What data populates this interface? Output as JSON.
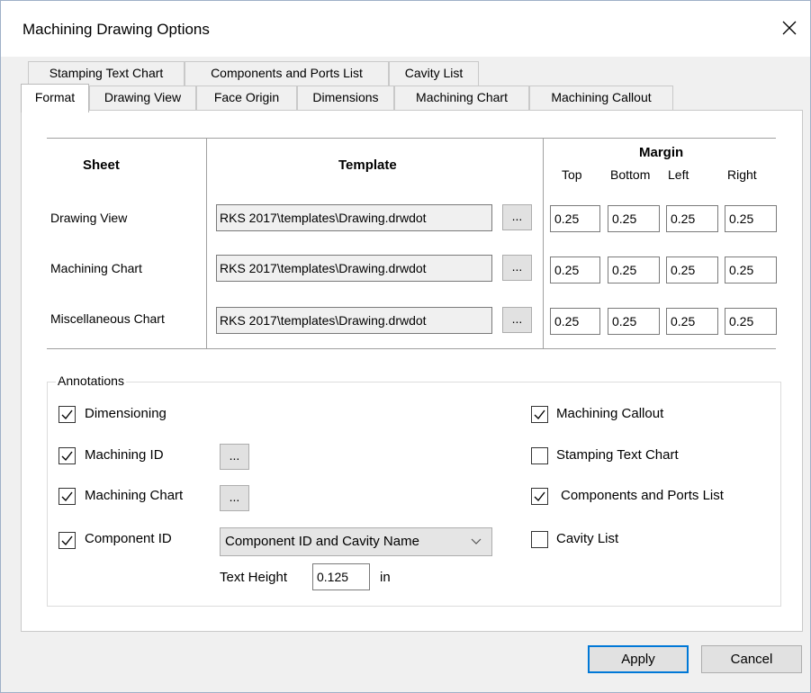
{
  "window": {
    "title": "Machining Drawing Options"
  },
  "tabs_row1": [
    "Stamping Text Chart",
    "Components and Ports List",
    "Cavity List"
  ],
  "tabs_row2": [
    "Format",
    "Drawing View",
    "Face Origin",
    "Dimensions",
    "Machining Chart",
    "Machining Callout"
  ],
  "active_tab": "Format",
  "table": {
    "col_sheet": "Sheet",
    "col_template": "Template",
    "col_margin": "Margin",
    "margin_cols": [
      "Top",
      "Bottom",
      "Left",
      "Right"
    ],
    "browse_label": "...",
    "rows": [
      {
        "sheet": "Drawing View",
        "template": "RKS 2017\\templates\\Drawing.drwdot",
        "top": "0.25",
        "bottom": "0.25",
        "left": "0.25",
        "right": "0.25"
      },
      {
        "sheet": "Machining Chart",
        "template": "RKS 2017\\templates\\Drawing.drwdot",
        "top": "0.25",
        "bottom": "0.25",
        "left": "0.25",
        "right": "0.25"
      },
      {
        "sheet": "Miscellaneous Chart",
        "template": "RKS 2017\\templates\\Drawing.drwdot",
        "top": "0.25",
        "bottom": "0.25",
        "left": "0.25",
        "right": "0.25"
      }
    ]
  },
  "annotations": {
    "label": "Annotations",
    "left": [
      {
        "label": "Dimensioning",
        "checked": true
      },
      {
        "label": "Machining ID",
        "checked": true
      },
      {
        "label": "Machining Chart",
        "checked": true
      },
      {
        "label": "Component ID",
        "checked": true
      }
    ],
    "right": [
      {
        "label": "Machining Callout",
        "checked": true
      },
      {
        "label": "Stamping Text Chart",
        "checked": false
      },
      {
        "label": "Components and Ports List",
        "checked": true
      },
      {
        "label": "Cavity List",
        "checked": false
      }
    ],
    "browse_label": "...",
    "component_id_mode": "Component ID and Cavity Name",
    "text_height_label": "Text Height",
    "text_height_value": "0.125",
    "text_height_unit": "in"
  },
  "buttons": {
    "apply": "Apply",
    "cancel": "Cancel"
  }
}
